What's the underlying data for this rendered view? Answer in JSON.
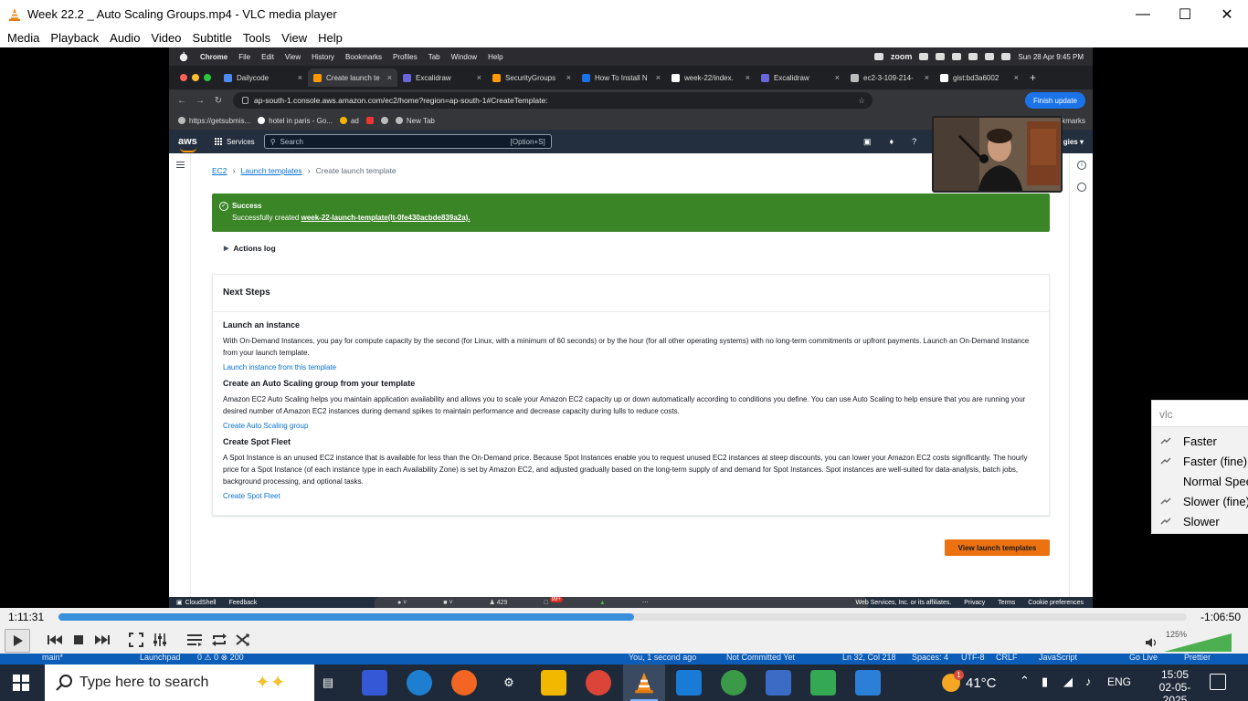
{
  "vlc": {
    "title": "Week 22.2 _ Auto Scaling Groups.mp4 - VLC media player",
    "menu": [
      "Media",
      "Playback",
      "Audio",
      "Video",
      "Subtitle",
      "Tools",
      "View",
      "Help"
    ],
    "time_elapsed": "1:11:31",
    "time_remaining": "-1:06:50",
    "progress": 0.51,
    "volume_label": "125%",
    "volume": 1.25,
    "speed_menu": {
      "header": "vlc",
      "items": [
        "Faster",
        "Faster (fine)",
        "Normal Speed",
        "Slower (fine)",
        "Slower"
      ]
    }
  },
  "mac": {
    "menubar": [
      "Chrome",
      "File",
      "Edit",
      "View",
      "History",
      "Bookmarks",
      "Profiles",
      "Tab",
      "Window",
      "Help"
    ],
    "zoom_label": "zoom",
    "clock": "Sun 28 Apr  9:45 PM"
  },
  "chrome": {
    "tabs": [
      {
        "label": "Dailycode",
        "color": "#4c8bf5"
      },
      {
        "label": "Create launch te",
        "color": "#ff9900"
      },
      {
        "label": "Excalidraw",
        "color": "#6965db"
      },
      {
        "label": "SecurityGroups",
        "color": "#ff9900"
      },
      {
        "label": "How To Install N",
        "color": "#1a73e8"
      },
      {
        "label": "week-22/index.",
        "color": "#ffffff"
      },
      {
        "label": "Excalidraw",
        "color": "#6965db"
      },
      {
        "label": "ec2-3-109-214-",
        "color": "#bbbbbb"
      },
      {
        "label": "gist:bd3a6002",
        "color": "#ffffff"
      }
    ],
    "url": "ap-south-1.console.aws.amazon.com/ec2/home?region=ap-south-1#CreateTemplate:",
    "finish_update": "Finish update",
    "bookmarks": [
      "https://getsubmis...",
      "hotel in paris - Go...",
      "ad",
      "",
      "",
      "New Tab"
    ],
    "bookmarks_more": "okmarks"
  },
  "aws": {
    "logo": "aws",
    "services": "Services",
    "search_placeholder": "Search",
    "search_shortcut": "[Option+S]",
    "region": "gies ▾",
    "breadcrumb": [
      "EC2",
      "Launch templates",
      "Create launch template"
    ],
    "flash": {
      "title": "Success",
      "message": "Successfully created ",
      "link": "week-22-launch-template(lt-0fe430acbde839a2a)."
    },
    "actions_log": "Actions log",
    "next_steps": {
      "title": "Next Steps",
      "steps": [
        {
          "title": "Launch an instance",
          "text": "With On-Demand Instances, you pay for compute capacity by the second (for Linux, with a minimum of 60 seconds) or by the hour (for all other operating systems) with no long-term commitments or upfront payments. Launch an On-Demand Instance from your launch template.",
          "link": "Launch instance from this template"
        },
        {
          "title": "Create an Auto Scaling group from your template",
          "text": "Amazon EC2 Auto Scaling helps you maintain application availability and allows you to scale your Amazon EC2 capacity up or down automatically according to conditions you define. You can use Auto Scaling to help ensure that you are running your desired number of Amazon EC2 instances during demand spikes to maintain performance and decrease capacity during lulls to reduce costs.",
          "link": "Create Auto Scaling group"
        },
        {
          "title": "Create Spot Fleet",
          "text": "A Spot Instance is an unused EC2 instance that is available for less than the On-Demand price. Because Spot Instances enable you to request unused EC2 instances at steep discounts, you can lower your Amazon EC2 costs significantly. The hourly price for a Spot Instance (of each instance type in each Availability Zone) is set by Amazon EC2, and adjusted gradually based on the long-term supply of and demand for Spot Instances. Spot instances are well-suited for data-analysis, batch jobs, background processing, and optional tasks.",
          "link": "Create Spot Fleet"
        }
      ]
    },
    "view_button": "View launch templates",
    "footer": {
      "cloudshell": "CloudShell",
      "feedback": "Feedback",
      "copyright": "Web Services, Inc. or its affiliates.",
      "privacy": "Privacy",
      "terms": "Terms",
      "cookies": "Cookie preferences",
      "participants": "429",
      "badge": "99+"
    }
  },
  "vscode_strip": {
    "branch": "main*",
    "launchpad": "Launchpad",
    "problems": "0 ⚠ 0 ⊗ 200",
    "blame": "You, 1 second ago",
    "commit": "Not Committed Yet",
    "position": "Ln 32, Col 218",
    "spaces": "Spaces: 4",
    "encoding": "UTF-8",
    "eol": "CRLF",
    "language": "JavaScript",
    "golive": "Go Live",
    "prettier": "Prettier"
  },
  "taskbar": {
    "search_placeholder": "Type here to search",
    "weather": "41°C",
    "weather_badge": "1",
    "language": "ENG",
    "time": "15:05",
    "date": "02-05-2025"
  }
}
